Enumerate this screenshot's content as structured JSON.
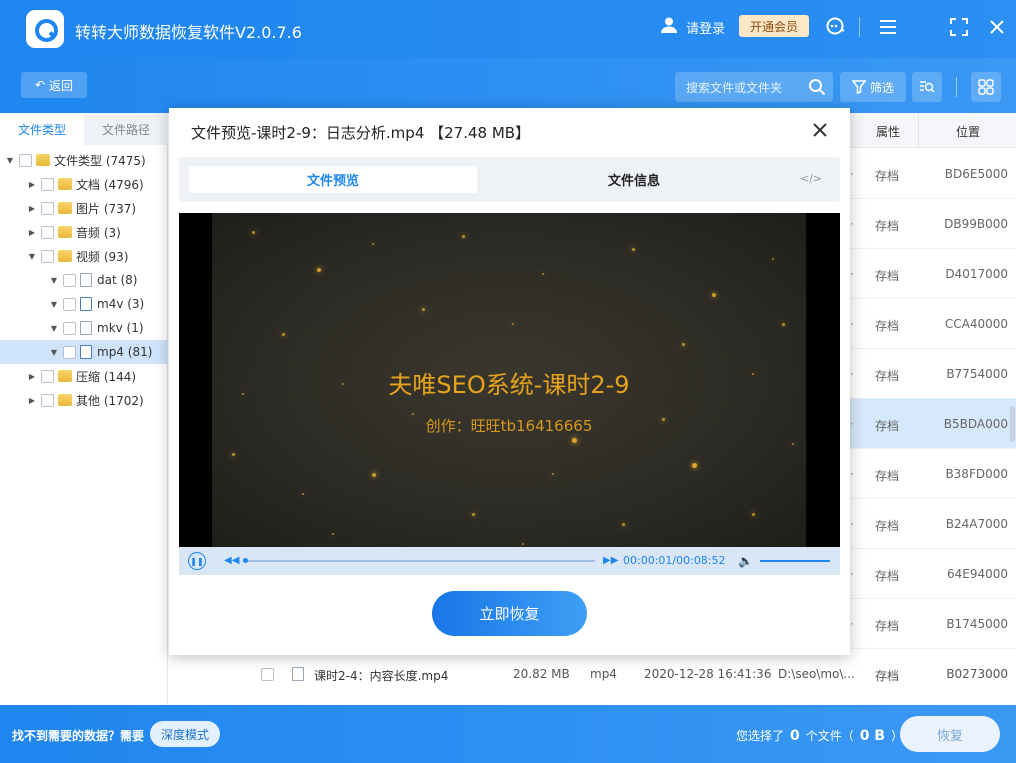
{
  "app": {
    "title": "转转大师数据恢复软件V2.0.7.6",
    "login_label": "请登录",
    "vip_label": "开通会员",
    "accent_color": "#1e86f0"
  },
  "toolbar": {
    "back_label": "返回",
    "search_placeholder": "搜索文件或文件夹",
    "filter_label": "筛选"
  },
  "left": {
    "tabs": [
      {
        "label": "文件类型",
        "active": true
      },
      {
        "label": "文件路径",
        "active": false
      }
    ],
    "tree": [
      {
        "label": "文件类型 (7475)",
        "level": 0,
        "expanded": true,
        "icon": "folder-icon"
      },
      {
        "label": "文档 (4796)",
        "level": 1,
        "expanded": false,
        "icon": "folder-icon"
      },
      {
        "label": "图片 (737)",
        "level": 1,
        "expanded": false,
        "icon": "folder-icon"
      },
      {
        "label": "音频 (3)",
        "level": 1,
        "expanded": false,
        "icon": "folder-icon"
      },
      {
        "label": "视频 (93)",
        "level": 1,
        "expanded": true,
        "icon": "folder-icon"
      },
      {
        "label": "dat (8)",
        "level": 2,
        "expanded": true,
        "icon": "file-icon"
      },
      {
        "label": "m4v (3)",
        "level": 2,
        "expanded": true,
        "icon": "video-file-icon"
      },
      {
        "label": "mkv (1)",
        "level": 2,
        "expanded": true,
        "icon": "file-icon"
      },
      {
        "label": "mp4 (81)",
        "level": 2,
        "expanded": true,
        "icon": "video-file-icon",
        "selected": true
      },
      {
        "label": "压缩 (144)",
        "level": 1,
        "expanded": false,
        "icon": "folder-icon"
      },
      {
        "label": "其他 (1702)",
        "level": 1,
        "expanded": false,
        "icon": "folder-icon"
      }
    ]
  },
  "list": {
    "headers": {
      "attr": "属性",
      "pos": "位置"
    },
    "rows": [
      {
        "attr": "存档",
        "pos": "BD6E5000"
      },
      {
        "attr": "存档",
        "pos": "DB99B000"
      },
      {
        "attr": "存档",
        "pos": "D4017000"
      },
      {
        "attr": "存档",
        "pos": "CCA40000"
      },
      {
        "attr": "存档",
        "pos": "B7754000"
      },
      {
        "attr": "存档",
        "pos": "B5BDA000",
        "selected": true
      },
      {
        "attr": "存档",
        "pos": "B38FD000"
      },
      {
        "attr": "存档",
        "pos": "B24A7000"
      },
      {
        "attr": "存档",
        "pos": "64E94000"
      },
      {
        "attr": "存档",
        "pos": "B1745000"
      }
    ],
    "last_row": {
      "name": "课时2-4：内容长度.mp4",
      "size": "20.82 MB",
      "type": "mp4",
      "date": "2020-12-28 16:41:36",
      "path": "D:\\seo\\mo\\...",
      "attr": "存档",
      "pos": "B0273000"
    }
  },
  "modal": {
    "title": "文件预览-课时2-9：日志分析.mp4 【27.48 MB】",
    "tab_preview": "文件预览",
    "tab_info": "文件信息",
    "code_icon": "</>",
    "video_title": "夫唯SEO系统-课时2-9",
    "video_sub": "创作：旺旺tb16416665",
    "time": "00:00:01/00:08:52",
    "progress": 0.002,
    "recover_label": "立即恢复"
  },
  "bottom": {
    "not_found": "找不到需要的数据？需要",
    "deep_mode": "深度模式",
    "sel_prefix": "您选择了",
    "sel_count": "0",
    "sel_mid": "个文件（",
    "sel_size": "0 B",
    "sel_suffix": "）",
    "recover_label": "恢复"
  }
}
